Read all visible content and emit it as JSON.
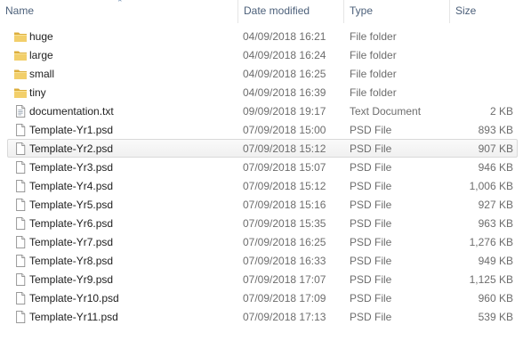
{
  "columns": {
    "name": "Name",
    "date": "Date modified",
    "type": "Type",
    "size": "Size"
  },
  "files": [
    {
      "name": "huge",
      "date": "04/09/2018 16:21",
      "type": "File folder",
      "size": "",
      "icon": "folder-icon"
    },
    {
      "name": "large",
      "date": "04/09/2018 16:24",
      "type": "File folder",
      "size": "",
      "icon": "folder-icon"
    },
    {
      "name": "small",
      "date": "04/09/2018 16:25",
      "type": "File folder",
      "size": "",
      "icon": "folder-icon"
    },
    {
      "name": "tiny",
      "date": "04/09/2018 16:39",
      "type": "File folder",
      "size": "",
      "icon": "folder-icon"
    },
    {
      "name": "documentation.txt",
      "date": "09/09/2018 19:17",
      "type": "Text Document",
      "size": "2 KB",
      "icon": "text-file-icon"
    },
    {
      "name": "Template-Yr1.psd",
      "date": "07/09/2018 15:00",
      "type": "PSD File",
      "size": "893 KB",
      "icon": "file-icon"
    },
    {
      "name": "Template-Yr2.psd",
      "date": "07/09/2018 15:12",
      "type": "PSD File",
      "size": "907 KB",
      "icon": "file-icon"
    },
    {
      "name": "Template-Yr3.psd",
      "date": "07/09/2018 15:07",
      "type": "PSD File",
      "size": "946 KB",
      "icon": "file-icon"
    },
    {
      "name": "Template-Yr4.psd",
      "date": "07/09/2018 15:12",
      "type": "PSD File",
      "size": "1,006 KB",
      "icon": "file-icon"
    },
    {
      "name": "Template-Yr5.psd",
      "date": "07/09/2018 15:16",
      "type": "PSD File",
      "size": "927 KB",
      "icon": "file-icon"
    },
    {
      "name": "Template-Yr6.psd",
      "date": "07/09/2018 15:35",
      "type": "PSD File",
      "size": "963 KB",
      "icon": "file-icon"
    },
    {
      "name": "Template-Yr7.psd",
      "date": "07/09/2018 16:25",
      "type": "PSD File",
      "size": "1,276 KB",
      "icon": "file-icon"
    },
    {
      "name": "Template-Yr8.psd",
      "date": "07/09/2018 16:33",
      "type": "PSD File",
      "size": "949 KB",
      "icon": "file-icon"
    },
    {
      "name": "Template-Yr9.psd",
      "date": "07/09/2018 17:07",
      "type": "PSD File",
      "size": "1,125 KB",
      "icon": "file-icon"
    },
    {
      "name": "Template-Yr10.psd",
      "date": "07/09/2018 17:09",
      "type": "PSD File",
      "size": "960 KB",
      "icon": "file-icon"
    },
    {
      "name": "Template-Yr11.psd",
      "date": "07/09/2018 17:13",
      "type": "PSD File",
      "size": "539 KB",
      "icon": "file-icon"
    }
  ],
  "hovered_row": 6,
  "colors": {
    "header_text": "#4c607a",
    "folder": "#e8c15a",
    "hover_border": "#d9d9d9"
  }
}
